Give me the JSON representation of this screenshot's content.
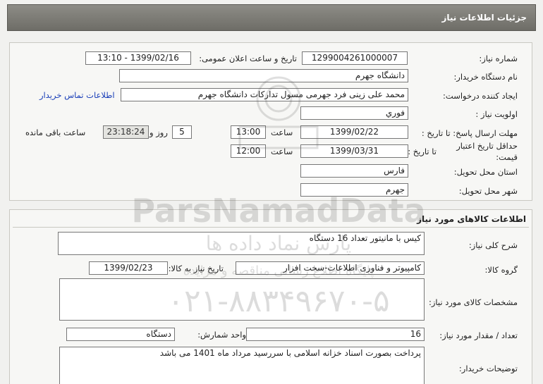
{
  "header": {
    "title": "جزئیات اطلاعات نیاز"
  },
  "need": {
    "need_no_label": "شماره نیاز:",
    "need_no": "1299004261000007",
    "announce_label": "تاریخ و ساعت اعلان عمومی:",
    "announce_value": "1399/02/16 - 13:10",
    "buyer_org_label": "نام دستگاه خریدار:",
    "buyer_org": "دانشگاه جهرم",
    "creator_label": "ایجاد کننده درخواست:",
    "creator": "محمد علی زینی فرد جهرمی مسول تدارکات دانشگاه جهرم",
    "contact_link": "اطلاعات تماس خریدار",
    "priority_label": "اولویت نیاز :",
    "priority": "فوري",
    "deadline_label": "مهلت ارسال پاسخ: تا تاریخ :",
    "deadline_date": "1399/02/22",
    "time_label": "ساعت",
    "deadline_time": "13:00",
    "days_value": "5",
    "days_label": "روز و",
    "remaining_time": "23:18:24",
    "remaining_label": "ساعت باقی مانده",
    "validity_label_1": "حداقل تاریخ اعتبار",
    "validity_label_2": "قیمت:",
    "validity_to_label": "تا تاریخ :",
    "validity_date": "1399/03/31",
    "validity_time_label": "ساعت",
    "validity_time": "12:00",
    "province_label": "استان محل تحویل:",
    "province": "فارس",
    "city_label": "شهر محل تحویل:",
    "city": "جهرم"
  },
  "goods": {
    "section_title": "اطلاعات کالاهای مورد نیاز",
    "summary_label": "شرح کلی نیاز:",
    "summary": "کیس با مانیتور تعداد 16 دستگاه",
    "group_label": "گروه کالا:",
    "group": "کامپیوتر و فناوری اطلاعات-سخت افزار",
    "need_date_label": "تاریخ نیاز به کالا:",
    "need_date": "1399/02/23",
    "specs_label": "مشخصات کالای مورد نیاز:",
    "specs": "",
    "qty_label": "تعداد / مقدار مورد نیاز:",
    "qty": "16",
    "unit_label": "واحد شمارش:",
    "unit": "دستگاه",
    "buyer_notes_label": "توضیحات خریدار:",
    "buyer_notes": "پرداخت بصورت اسناد خزانه اسلامی با سررسید مرداد ماه 1401 می باشد"
  },
  "watermark": {
    "brand": "ParsNamadData",
    "brand_fa": "پارس نماد داده ها",
    "line1": "پایگاه اطلاع رسانی مناقصه و مزایده",
    "phone": "۰۲۱-۸۸۳۴۹۶۷۰-۵"
  }
}
